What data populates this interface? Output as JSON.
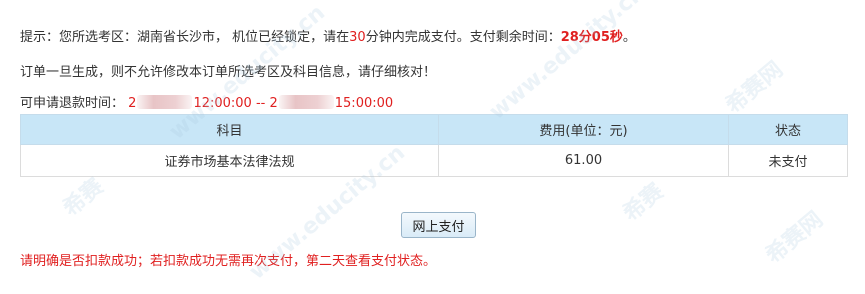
{
  "notice": {
    "prefix": "提示：您所选考区：湖南省长沙市，  机位已经锁定，请在",
    "minutes": "30",
    "middle": "分钟内完成支付。支付剩余时间：",
    "remaining": "28分05秒",
    "suffix": "。"
  },
  "warning": "订单一旦生成，则不允许修改本订单所选考区及科目信息，请仔细核对！",
  "refund": {
    "label": "可申请退款时间：",
    "start_prefix": "2",
    "start_time": "12:00:00",
    "separator": " -- ",
    "end_prefix": "2",
    "end_time": "15:00:00"
  },
  "table": {
    "headers": [
      "科目",
      "费用(单位：元)",
      "状态"
    ],
    "rows": [
      [
        "证券市场基本法律法规",
        "61.00",
        "未支付"
      ]
    ]
  },
  "pay_button": "网上支付",
  "bottom_note": "请明确是否扣款成功；若扣款成功无需再次支付，第二天查看支付状态。",
  "watermark": {
    "brand": "希赛",
    "domain": "www.educity.cn",
    "site": "希赛网"
  },
  "colors": {
    "alert_red": "#e02020",
    "header_blue": "#c8e6f7"
  }
}
